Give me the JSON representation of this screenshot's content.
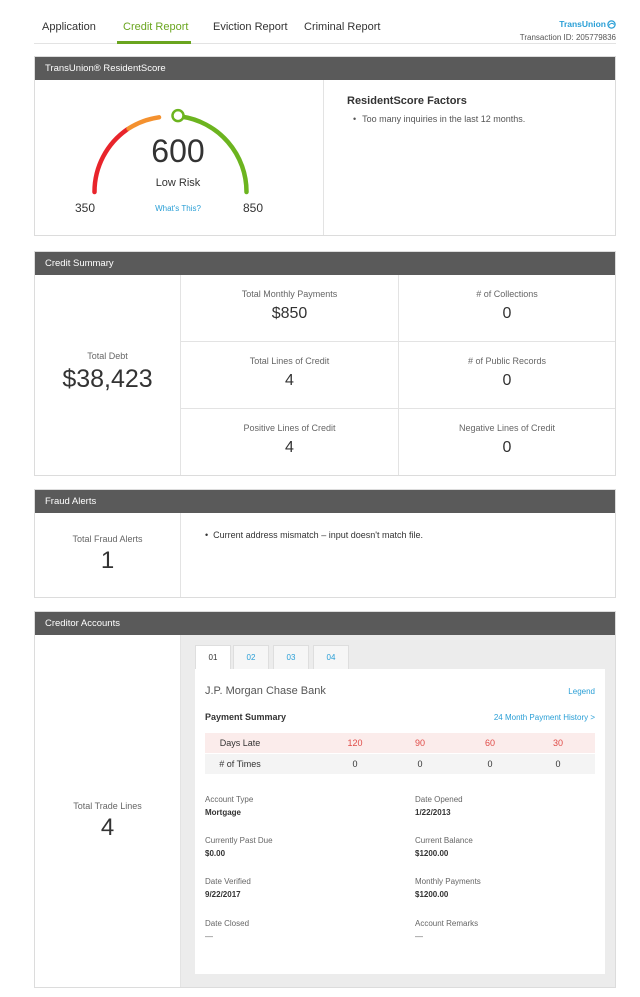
{
  "nav": {
    "tabs": [
      {
        "label": "Application"
      },
      {
        "label": "Credit Report"
      },
      {
        "label": "Eviction Report"
      },
      {
        "label": "Criminal Report"
      }
    ],
    "active_tab": "Credit Report",
    "brand": "TransUnion",
    "transaction": "Transaction ID: 205779836"
  },
  "resident_score": {
    "header": "TransUnion® ResidentScore",
    "score": "600",
    "risk": "Low Risk",
    "min": "350",
    "max": "850",
    "whats_this": "What's This?",
    "factors_title": "ResidentScore Factors",
    "factors": [
      "Too many inquiries in the last 12 months."
    ],
    "gauge_colors": {
      "red": "#e8242b",
      "orange": "#f4912f",
      "green": "#6cb41f"
    }
  },
  "credit_summary": {
    "header": "Credit Summary",
    "total_debt_label": "Total Debt",
    "total_debt": "$38,423",
    "cells": [
      {
        "label": "Total Monthly Payments",
        "value": "$850"
      },
      {
        "label": "# of Collections",
        "value": "0"
      },
      {
        "label": "Total Lines of Credit",
        "value": "4"
      },
      {
        "label": "# of Public Records",
        "value": "0"
      },
      {
        "label": "Positive Lines of Credit",
        "value": "4"
      },
      {
        "label": "Negative Lines of Credit",
        "value": "0"
      }
    ]
  },
  "fraud_alerts": {
    "header": "Fraud Alerts",
    "total_label": "Total Fraud Alerts",
    "total": "1",
    "alerts": [
      "Current address mismatch – input doesn't match file."
    ]
  },
  "creditor_accounts": {
    "header": "Creditor Accounts",
    "total_label": "Total Trade Lines",
    "total": "4",
    "tabs": [
      "01",
      "02",
      "03",
      "04"
    ],
    "active_tab": "01",
    "bank": "J.P. Morgan Chase Bank",
    "legend": "Legend",
    "payment_summary": "Payment Summary",
    "history_link": "24 Month Payment History >",
    "days_late_label": "Days Late",
    "days_late": [
      "120",
      "90",
      "60",
      "30"
    ],
    "times_label": "# of Times",
    "times": [
      "0",
      "0",
      "0",
      "0"
    ],
    "details": [
      {
        "label": "Account Type",
        "value": "Mortgage"
      },
      {
        "label": "Date Opened",
        "value": "1/22/2013"
      },
      {
        "label": "Currently Past Due",
        "value": "$0.00"
      },
      {
        "label": "Current Balance",
        "value": "$1200.00"
      },
      {
        "label": "Date Verified",
        "value": "9/22/2017"
      },
      {
        "label": "Monthly Payments",
        "value": "$1200.00"
      },
      {
        "label": "Date Closed",
        "value": "—"
      },
      {
        "label": "Account Remarks",
        "value": "—"
      }
    ]
  }
}
